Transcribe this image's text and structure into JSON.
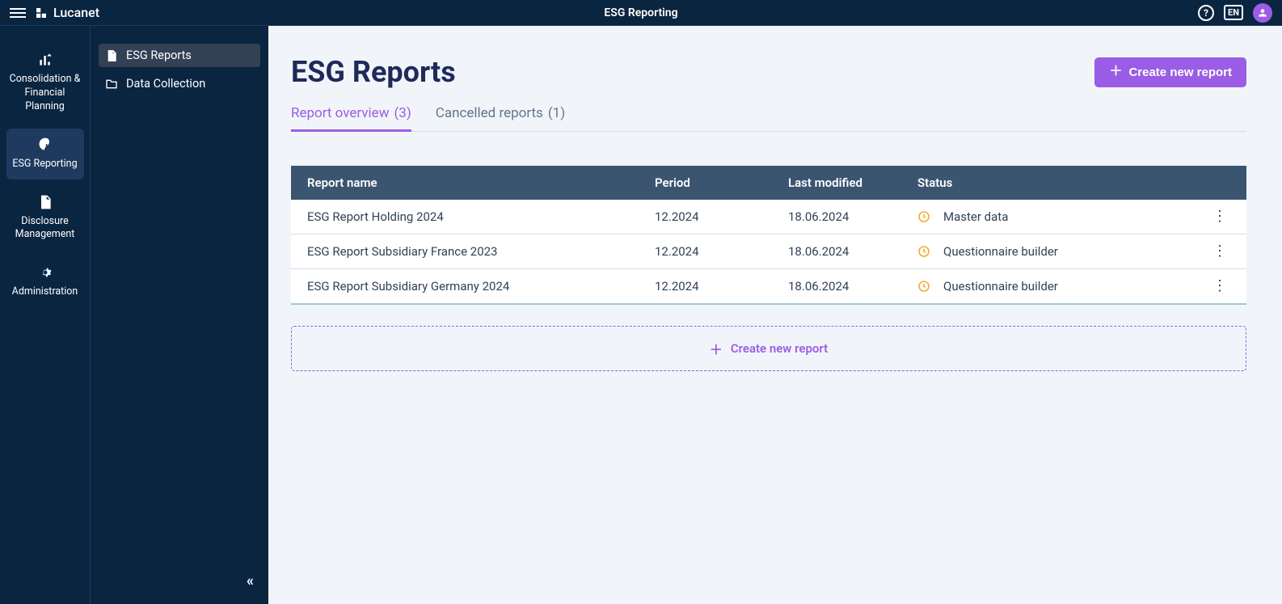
{
  "header": {
    "brand": "Lucanet",
    "title": "ESG Reporting",
    "lang": "EN"
  },
  "navrail": {
    "items": [
      {
        "id": "consolidation",
        "label": "Consolidation & Financial Planning"
      },
      {
        "id": "esg",
        "label": "ESG Reporting"
      },
      {
        "id": "disclosure",
        "label": "Disclosure Management"
      },
      {
        "id": "admin",
        "label": "Administration"
      }
    ]
  },
  "sidebar": {
    "items": [
      {
        "id": "esg-reports",
        "label": "ESG Reports"
      },
      {
        "id": "data-collection",
        "label": "Data Collection"
      }
    ]
  },
  "page": {
    "title": "ESG Reports",
    "create_button": "Create new report",
    "create_row_label": "Create new report"
  },
  "tabs": [
    {
      "id": "overview",
      "label": "Report overview",
      "count": "(3)"
    },
    {
      "id": "cancelled",
      "label": "Cancelled reports",
      "count": "(1)"
    }
  ],
  "table": {
    "columns": {
      "name": "Report name",
      "period": "Period",
      "modified": "Last modified",
      "status": "Status"
    },
    "rows": [
      {
        "name": "ESG Report Holding 2024",
        "period": "12.2024",
        "modified": "18.06.2024",
        "status": "Master data"
      },
      {
        "name": "ESG Report Subsidiary France 2023",
        "period": "12.2024",
        "modified": "18.06.2024",
        "status": "Questionnaire builder"
      },
      {
        "name": "ESG Report Subsidiary Germany 2024",
        "period": "12.2024",
        "modified": "18.06.2024",
        "status": "Questionnaire builder"
      }
    ]
  }
}
